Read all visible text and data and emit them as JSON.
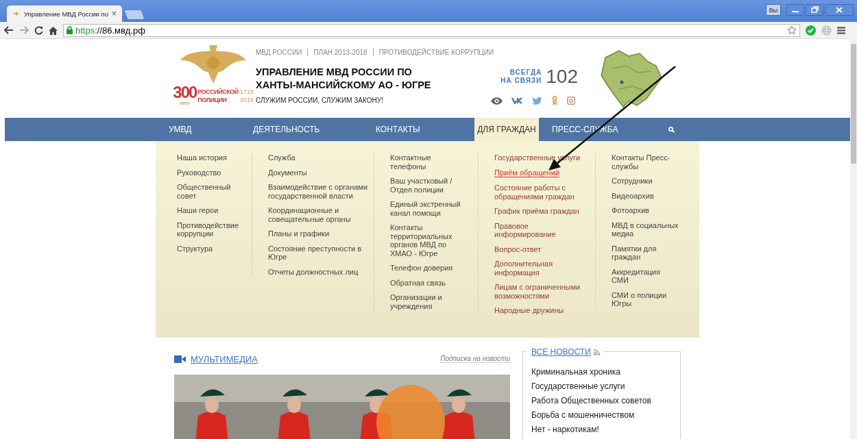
{
  "browser": {
    "tab_title": "Управление МВД России по",
    "tab_close": "×",
    "url_scheme": "https",
    "url_rest": "://86.мвд.рф",
    "profile": "Вы"
  },
  "header": {
    "top_links": [
      "МВД РОССИИ",
      "ПЛАН 2013-2018",
      "ПРОТИВОДЕЙСТВИЕ КОРРУПЦИИ"
    ],
    "logo": {
      "anniversary": "300",
      "years": "лет",
      "lines": [
        "РОССИЙСКОЙ",
        "ПОЛИЦИИ"
      ],
      "dates": [
        "1718",
        "2018"
      ]
    },
    "title_lines": [
      "УПРАВЛЕНИЕ МВД РОССИИ ПО",
      "ХАНТЫ-МАНСИЙСКОМУ АО - ЮГРЕ"
    ],
    "motto": "СЛУЖИМ РОССИИ, СЛУЖИМ ЗАКОНУ!",
    "hotline_label": [
      "ВСЕГДА",
      "НА СВЯЗИ"
    ],
    "hotline_number": "102"
  },
  "nav": [
    {
      "label": "УМВД",
      "selected": false
    },
    {
      "label": "ДЕЯТЕЛЬНОСТЬ",
      "selected": false
    },
    {
      "label": "КОНТАКТЫ",
      "selected": false
    },
    {
      "label": "ДЛЯ ГРАЖДАН",
      "selected": true
    },
    {
      "label": "ПРЕСС-СЛУЖБА",
      "selected": false
    }
  ],
  "menu": [
    {
      "active": false,
      "items": [
        {
          "label": "Наша история",
          "selected": false
        },
        {
          "label": "Руководство",
          "selected": false
        },
        {
          "label": "Общественный совет",
          "selected": false
        },
        {
          "label": "Наши герои",
          "selected": false
        },
        {
          "label": "Противодействие коррупции",
          "selected": false
        },
        {
          "label": "Структура",
          "selected": false
        }
      ]
    },
    {
      "active": false,
      "items": [
        {
          "label": "Служба",
          "selected": false
        },
        {
          "label": "Документы",
          "selected": false
        },
        {
          "label": "Взаимодействие с органами государственной власти",
          "selected": false
        },
        {
          "label": "Координационные и совещательные органы",
          "selected": false
        },
        {
          "label": "Планы и графики",
          "selected": false
        },
        {
          "label": "Состояние преступности в Югре",
          "selected": false
        },
        {
          "label": "Отчеты должностных лиц",
          "selected": false
        }
      ]
    },
    {
      "active": false,
      "items": [
        {
          "label": "Контактные телефоны",
          "selected": false
        },
        {
          "label": "Ваш участковый / Отдел полиции",
          "selected": false
        },
        {
          "label": "Единый экстренный канал помощи",
          "selected": false
        },
        {
          "label": "Контакты территориальных органов МВД по ХМАО - Югре",
          "selected": false
        },
        {
          "label": "Телефон доверия",
          "selected": false
        },
        {
          "label": "Обратная связь",
          "selected": false
        },
        {
          "label": "Организации и учреждения",
          "selected": false
        }
      ]
    },
    {
      "active": true,
      "items": [
        {
          "label": "Государственные услуги",
          "selected": false
        },
        {
          "label": "Приём обращений",
          "selected": true
        },
        {
          "label": "Состояние работы с обращениями граждан",
          "selected": false
        },
        {
          "label": "График приёма граждан",
          "selected": false
        },
        {
          "label": "Правовое информирование",
          "selected": false
        },
        {
          "label": "Вопрос-ответ",
          "selected": false
        },
        {
          "label": "Дополнительная информация",
          "selected": false
        },
        {
          "label": "Лицам с ограниченными возможностями",
          "selected": false
        },
        {
          "label": "Народные дружины",
          "selected": false
        }
      ]
    },
    {
      "active": false,
      "items": [
        {
          "label": "Контакты Пресс-службы",
          "selected": false
        },
        {
          "label": "Сотрудники",
          "selected": false
        },
        {
          "label": "Видеоархив",
          "selected": false
        },
        {
          "label": "Фотоархив",
          "selected": false
        },
        {
          "label": "МВД в социальных медиа",
          "selected": false
        },
        {
          "label": "Памятки для граждан",
          "selected": false
        },
        {
          "label": "Аккредитация СМИ",
          "selected": false
        },
        {
          "label": "СМИ о полиции Югры",
          "selected": false
        }
      ]
    }
  ],
  "multimedia": {
    "title": "МУЛЬТИМЕДИА",
    "subscribe": "Подписка на новости"
  },
  "news": {
    "title": "ВСЕ НОВОСТИ",
    "items": [
      "Криминальная хроника",
      "Государственные услуги",
      "Работа Общественных советов",
      "Борьба с мошенничеством",
      "Нет - наркотикам!"
    ]
  }
}
